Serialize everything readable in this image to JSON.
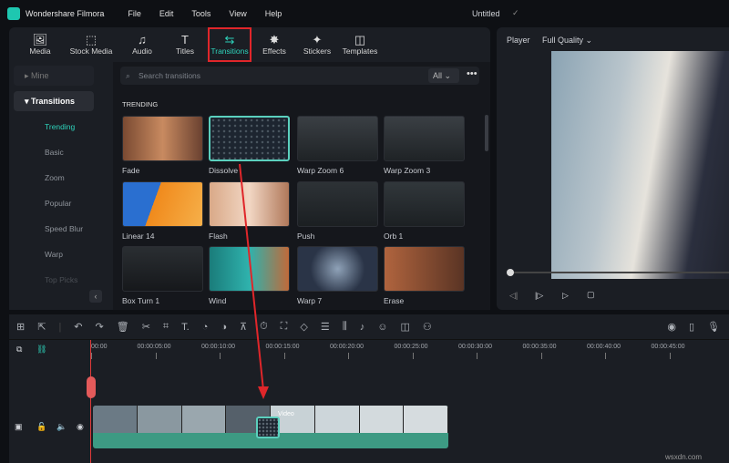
{
  "app": {
    "name": "Wondershare Filmora",
    "menu": [
      "File",
      "Edit",
      "Tools",
      "View",
      "Help"
    ],
    "doc_title": "Untitled"
  },
  "tabs": [
    {
      "label": "Media",
      "icon": "🖼"
    },
    {
      "label": "Stock Media",
      "icon": "⬚"
    },
    {
      "label": "Audio",
      "icon": "♫"
    },
    {
      "label": "Titles",
      "icon": "T"
    },
    {
      "label": "Transitions",
      "icon": "⇆"
    },
    {
      "label": "Effects",
      "icon": "✸"
    },
    {
      "label": "Stickers",
      "icon": "✦"
    },
    {
      "label": "Templates",
      "icon": "◫"
    }
  ],
  "sidebar": {
    "mine": "Mine",
    "transitions": "Transitions",
    "items": [
      "Trending",
      "Basic",
      "Zoom",
      "Popular",
      "Speed Blur",
      "Warp",
      "Top Picks"
    ]
  },
  "search": {
    "placeholder": "Search transitions",
    "filter": "All"
  },
  "section": "TRENDING",
  "grid": [
    {
      "label": "Fade",
      "bg": "linear-gradient(90deg,#7a4a32,#c88a60,#6a4130)"
    },
    {
      "label": "Dissolve",
      "bg": "radial-gradient(circle,#4a5560 1px,#1d2530 1.5px) 0 0/6px 6px"
    },
    {
      "label": "Warp Zoom 6",
      "bg": "linear-gradient(#3a3f44,#1f2326)"
    },
    {
      "label": "Warp Zoom 3",
      "bg": "linear-gradient(#3a3f44,#1f2326)"
    },
    {
      "label": "Linear 14",
      "bg": "linear-gradient(110deg,#2a6fd0 40%,#f08a1c 40%,#f6b04a)"
    },
    {
      "label": "Flash",
      "bg": "linear-gradient(90deg,#d9a988,#f2d7c4,#b0785a)"
    },
    {
      "label": "Push",
      "bg": "linear-gradient(#2d3236,#1b1f22)"
    },
    {
      "label": "Orb 1",
      "bg": "linear-gradient(#31373b,#1c2023)"
    },
    {
      "label": "Box Turn 1",
      "bg": "linear-gradient(#2a2e32,#16181b)"
    },
    {
      "label": "Wind",
      "bg": "linear-gradient(90deg,#1a7c7a,#2fb2ad,#c06a3a)"
    },
    {
      "label": "Warp 7",
      "bg": "radial-gradient(circle,#8fa2b8,#2a3447 60%)"
    },
    {
      "label": "Erase",
      "bg": "linear-gradient(90deg,#b0643e,#5a3424)"
    }
  ],
  "player": {
    "label": "Player",
    "quality": "Full Quality"
  },
  "ruler": [
    "00:00",
    "00:00:05:00",
    "00:00:10:00",
    "00:00:15:00",
    "00:00:20:00",
    "00:00:25:00",
    "00:00:30:00",
    "00:00:35:00",
    "00:00:40:00",
    "00:00:45:00"
  ],
  "clip_label": "Video",
  "watermark": "wsxdn.com",
  "colors": {
    "accent": "#2ed3bb",
    "highlight": "#e0262a",
    "clip": "#3d9a83"
  }
}
